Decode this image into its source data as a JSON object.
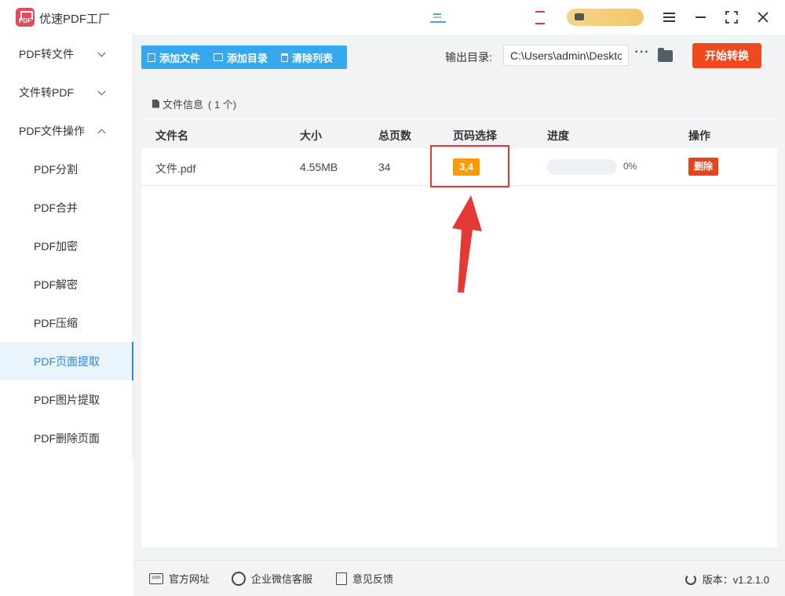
{
  "app": {
    "title": "优速PDF工厂",
    "logo_text": "PDF"
  },
  "window": {
    "menu": "menu",
    "minimize": "minimize",
    "maximize": "maximize",
    "close": "close"
  },
  "sidebar": {
    "items": [
      {
        "label": "PDF转文件",
        "chevron": "down"
      },
      {
        "label": "文件转PDF",
        "chevron": "down"
      },
      {
        "label": "PDF文件操作",
        "chevron": "up"
      },
      {
        "label": "PDF分割"
      },
      {
        "label": "PDF合并"
      },
      {
        "label": "PDF加密"
      },
      {
        "label": "PDF解密"
      },
      {
        "label": "PDF压缩"
      },
      {
        "label": "PDF页面提取",
        "active": true
      },
      {
        "label": "PDF图片提取"
      },
      {
        "label": "PDF删除页面"
      }
    ]
  },
  "toolbar": {
    "add_file": "添加文件",
    "add_dir": "添加目录",
    "clear_list": "清除列表",
    "output_label": "输出目录:",
    "output_path": "C:\\Users\\admin\\Deskto",
    "more": "···",
    "start": "开始转换"
  },
  "file_panel": {
    "header": "文件信息",
    "count": "( 1 个)",
    "columns": [
      "文件名",
      "大小",
      "总页数",
      "页码选择",
      "进度",
      "操作"
    ],
    "rows": [
      {
        "name": "文件.pdf",
        "size": "4.55MB",
        "pages": "34",
        "page_select": "3,4",
        "progress": 0,
        "progress_text": "0%",
        "action": "删除"
      }
    ]
  },
  "footer": {
    "website": "官方网址",
    "wechat": "企业微信客服",
    "feedback": "意见反馈",
    "version": "版本：v1.2.1.0",
    "web_icon_text": "com"
  },
  "colors": {
    "accent": "#36a8ee",
    "start": "#ef4a1d",
    "badge": "#ff9900",
    "highlight": "#e53935",
    "delete": "#e9431c"
  }
}
